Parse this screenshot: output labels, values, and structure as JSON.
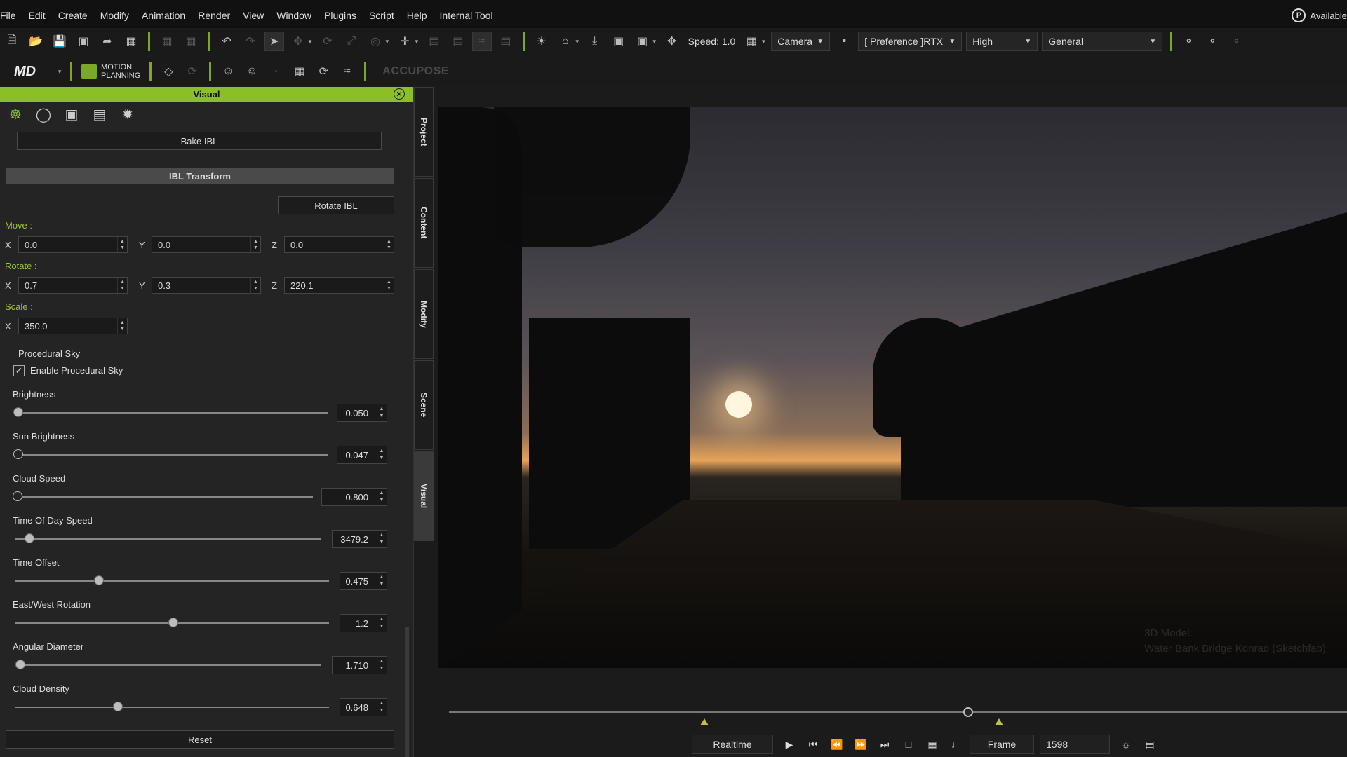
{
  "menubar": {
    "items": [
      "File",
      "Edit",
      "Create",
      "Modify",
      "Animation",
      "Render",
      "View",
      "Window",
      "Plugins",
      "Script",
      "Help",
      "Internal Tool"
    ],
    "status_text": "Available"
  },
  "toolbar": {
    "speed_label": "Speed: 1.0",
    "camera_dropdown": "Camera",
    "preference_dropdown": "[ Preference ]RTX",
    "quality_dropdown": "High",
    "mode_dropdown": "General",
    "motion_planning_line1": "MOTION",
    "motion_planning_line2": "PLANNING",
    "md_logo": "MD",
    "accupose_label": "ACCUPOSE"
  },
  "panel": {
    "title": "Visual",
    "bake_ibl": "Bake IBL",
    "section_title": "IBL Transform",
    "rotate_ibl": "Rotate IBL",
    "move_label": "Move :",
    "rotate_label": "Rotate :",
    "scale_label": "Scale :",
    "axis_x": "X",
    "axis_y": "Y",
    "axis_z": "Z",
    "move": {
      "x": "0.0",
      "y": "0.0",
      "z": "0.0"
    },
    "rotate": {
      "x": "0.7",
      "y": "0.3",
      "z": "220.1"
    },
    "scale": {
      "x": "350.0"
    },
    "procedural_sky_label": "Procedural Sky",
    "enable_procedural_sky": "Enable Procedural Sky",
    "enable_checked": true,
    "sliders": [
      {
        "label": "Brightness",
        "value": "0.050",
        "fraction": 0.0
      },
      {
        "label": "Sun Brightness",
        "value": "0.047",
        "fraction": 0.0
      },
      {
        "label": "Cloud Speed",
        "value": "0.800",
        "fraction": 0.0
      },
      {
        "label": "Time Of Day Speed",
        "value": "3479.2",
        "fraction": 0.05
      },
      {
        "label": "Time Offset",
        "value": "-0.475",
        "fraction": 0.27
      },
      {
        "label": "East/West Rotation",
        "value": "1.2",
        "fraction": 0.5
      },
      {
        "label": "Angular Diameter",
        "value": "1.710",
        "fraction": 0.02
      },
      {
        "label": "Cloud Density",
        "value": "0.648",
        "fraction": 0.33
      }
    ],
    "reset": "Reset"
  },
  "side_tabs": [
    "Project",
    "Content",
    "Modify",
    "Scene",
    "Visual"
  ],
  "viewport": {
    "watermark_line1": "3D Model:",
    "watermark_line2": "Water Bank Bridge Konrad (Sketchfab)"
  },
  "playback": {
    "realtime": "Realtime",
    "frame_label": "Frame",
    "frame_value": "1598"
  },
  "colors": {
    "accent": "#8cbf26",
    "section_bar": "#4a4a4a"
  }
}
